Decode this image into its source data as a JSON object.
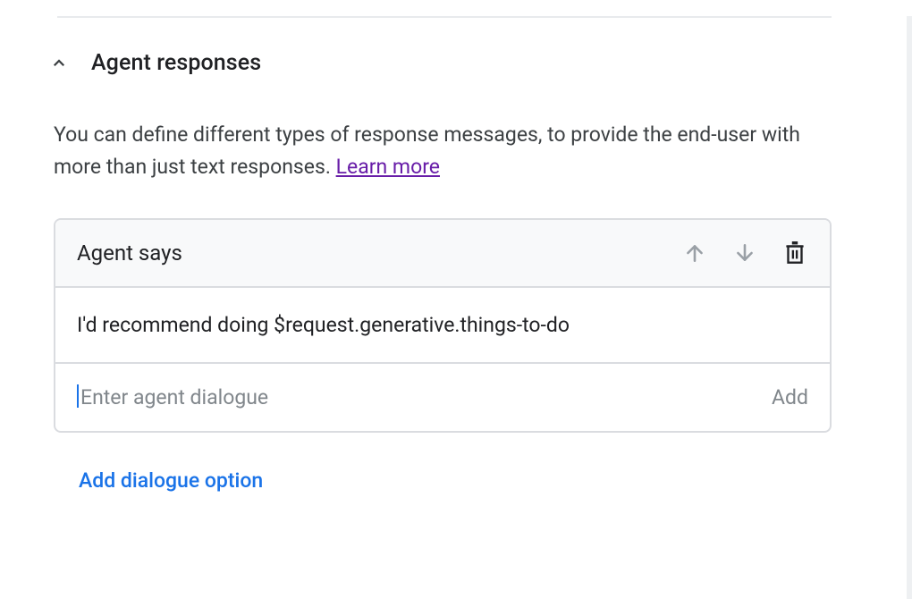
{
  "section": {
    "title": "Agent responses",
    "description_part1": "You can define different types of response messages, to provide the end-user with more than just text responses. ",
    "learn_more_label": "Learn more"
  },
  "card": {
    "header_label": "Agent says",
    "responses": [
      "I'd recommend doing $request.generative.things-to-do"
    ],
    "input_placeholder": "Enter agent dialogue",
    "add_button_label": "Add"
  },
  "actions": {
    "add_dialogue_option": "Add dialogue option"
  }
}
